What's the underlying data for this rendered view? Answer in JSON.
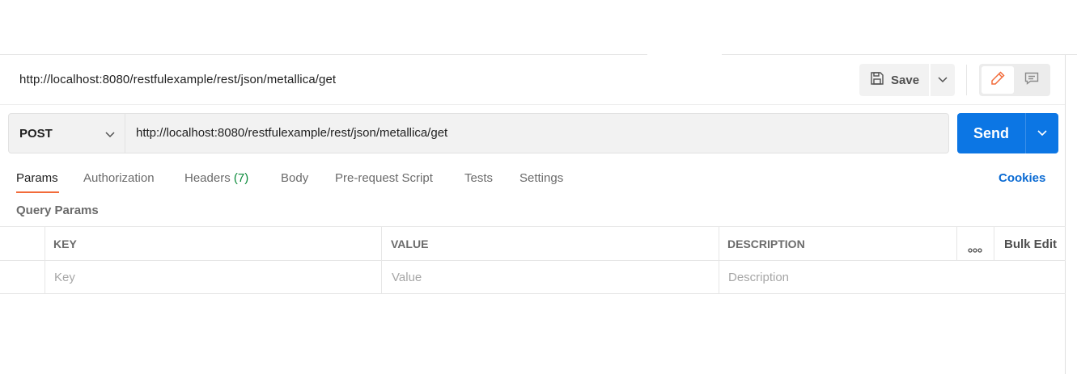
{
  "request": {
    "title": "http://localhost:8080/restfulexample/rest/json/metallica/get",
    "method": "POST",
    "url": "http://localhost:8080/restfulexample/rest/json/metallica/get"
  },
  "toolbar": {
    "save_label": "Save",
    "send_label": "Send"
  },
  "tabs": [
    {
      "label": "Params",
      "active": true
    },
    {
      "label": "Authorization"
    },
    {
      "label": "Headers",
      "count": "(7)"
    },
    {
      "label": "Body"
    },
    {
      "label": "Pre-request Script"
    },
    {
      "label": "Tests"
    },
    {
      "label": "Settings"
    }
  ],
  "cookies_label": "Cookies",
  "query_params": {
    "section_title": "Query Params",
    "columns": [
      "KEY",
      "VALUE",
      "DESCRIPTION"
    ],
    "bulk_edit_label": "Bulk Edit",
    "placeholders": {
      "key": "Key",
      "value": "Value",
      "description": "Description"
    }
  },
  "colors": {
    "accent": "#f26b3a",
    "send_button": "#0c76e4",
    "link": "#0b6bd3",
    "count": "#0a8a3a"
  },
  "icons": [
    "save-icon",
    "chevron-down-icon",
    "pencil-icon",
    "comment-icon",
    "more-horizontal-icon"
  ]
}
